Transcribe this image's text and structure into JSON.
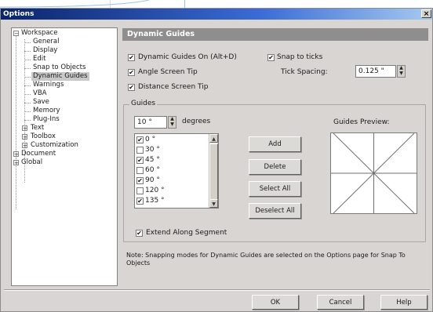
{
  "window": {
    "title": "Options",
    "close_glyph": "×"
  },
  "tree": {
    "workspace": {
      "label": "Workspace",
      "expander": "−"
    },
    "workspace_children": [
      "General",
      "Display",
      "Edit",
      "Snap to Objects",
      "Dynamic Guides",
      "Warnings",
      "VBA",
      "Save",
      "Memory",
      "Plug-Ins"
    ],
    "collapsed": [
      {
        "label": "Text",
        "expander": "+"
      },
      {
        "label": "Toolbox",
        "expander": "+"
      },
      {
        "label": "Customization",
        "expander": "+"
      }
    ],
    "top_level": [
      {
        "label": "Document",
        "expander": "+"
      },
      {
        "label": "Global",
        "expander": "+"
      }
    ],
    "selected": "Dynamic Guides"
  },
  "panel": {
    "header": "Dynamic Guides",
    "dynamic_guides_on": {
      "label": "Dynamic Guides On (Alt+D)",
      "checked": true
    },
    "snap_to_ticks": {
      "label": "Snap to ticks",
      "checked": true
    },
    "angle_screen_tip": {
      "label": "Angle Screen Tip",
      "checked": true
    },
    "distance_screen_tip": {
      "label": "Distance Screen Tip",
      "checked": true
    },
    "tick_spacing": {
      "label": "Tick Spacing:",
      "value": "0.125 \""
    },
    "guides_group_label": "Guides",
    "degrees": {
      "value": "10 °",
      "unit": "degrees"
    },
    "guide_angles": [
      {
        "label": "0 °",
        "checked": true
      },
      {
        "label": "30 °",
        "checked": false
      },
      {
        "label": "45 °",
        "checked": true
      },
      {
        "label": "60 °",
        "checked": false
      },
      {
        "label": "90 °",
        "checked": true
      },
      {
        "label": "120 °",
        "checked": false
      },
      {
        "label": "135 °",
        "checked": true
      }
    ],
    "buttons": {
      "add": "Add",
      "delete": "Delete",
      "select_all": "Select All",
      "deselect_all": "Deselect All"
    },
    "preview_label": "Guides Preview:",
    "extend_along_segment": {
      "label": "Extend Along Segment",
      "checked": true
    },
    "note": "Note: Snapping modes for Dynamic Guides are selected on the Options page for Snap To Objects"
  },
  "footer": {
    "ok": "OK",
    "cancel": "Cancel",
    "help": "Help"
  },
  "checkmark": "✔",
  "arrows": {
    "up": "▲",
    "down": "▼"
  },
  "colors": {
    "title_start": "#0a246a",
    "title_end": "#a6caf0",
    "header_bg": "#8e8e8e",
    "dialog_bg": "#d8d5d2",
    "background_decor": "#9cc1e6"
  }
}
